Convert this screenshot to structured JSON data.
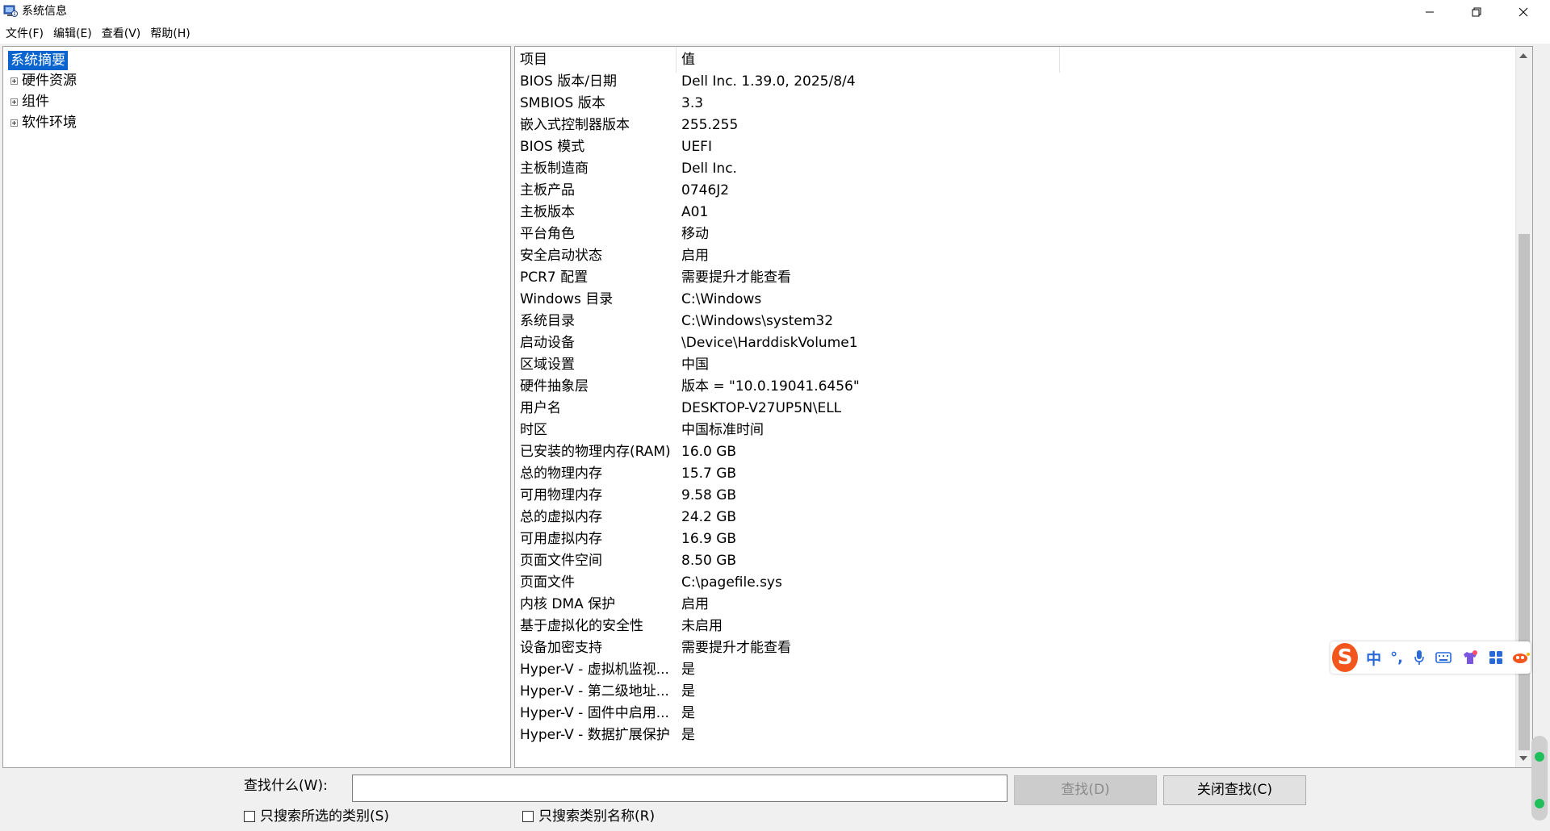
{
  "window": {
    "title": "系统信息"
  },
  "menu": [
    "文件(F)",
    "编辑(E)",
    "查看(V)",
    "帮助(H)"
  ],
  "tree": {
    "root": "系统摘要",
    "children": [
      "硬件资源",
      "组件",
      "软件环境"
    ]
  },
  "list": {
    "headers": {
      "item": "项目",
      "value": "值"
    },
    "rows": [
      {
        "item": "BIOS 版本/日期",
        "value": "Dell Inc. 1.39.0, 2025/8/4"
      },
      {
        "item": "SMBIOS 版本",
        "value": "3.3"
      },
      {
        "item": "嵌入式控制器版本",
        "value": "255.255"
      },
      {
        "item": "BIOS 模式",
        "value": "UEFI"
      },
      {
        "item": "主板制造商",
        "value": "Dell Inc."
      },
      {
        "item": "主板产品",
        "value": "0746J2"
      },
      {
        "item": "主板版本",
        "value": "A01"
      },
      {
        "item": "平台角色",
        "value": "移动"
      },
      {
        "item": "安全启动状态",
        "value": "启用"
      },
      {
        "item": "PCR7 配置",
        "value": "需要提升才能查看"
      },
      {
        "item": "Windows 目录",
        "value": "C:\\Windows"
      },
      {
        "item": "系统目录",
        "value": "C:\\Windows\\system32"
      },
      {
        "item": "启动设备",
        "value": "\\Device\\HarddiskVolume1"
      },
      {
        "item": "区域设置",
        "value": "中国"
      },
      {
        "item": "硬件抽象层",
        "value": "版本 = \"10.0.19041.6456\""
      },
      {
        "item": "用户名",
        "value": "DESKTOP-V27UP5N\\ELL"
      },
      {
        "item": "时区",
        "value": "中国标准时间"
      },
      {
        "item": "已安装的物理内存(RAM)",
        "value": "16.0 GB"
      },
      {
        "item": "总的物理内存",
        "value": "15.7 GB"
      },
      {
        "item": "可用物理内存",
        "value": "9.58 GB"
      },
      {
        "item": "总的虚拟内存",
        "value": "24.2 GB"
      },
      {
        "item": "可用虚拟内存",
        "value": "16.9 GB"
      },
      {
        "item": "页面文件空间",
        "value": "8.50 GB"
      },
      {
        "item": "页面文件",
        "value": "C:\\pagefile.sys"
      },
      {
        "item": "内核 DMA 保护",
        "value": "启用"
      },
      {
        "item": "基于虚拟化的安全性",
        "value": "未启用"
      },
      {
        "item": "设备加密支持",
        "value": "需要提升才能查看"
      },
      {
        "item": "Hyper-V - 虚拟机监视...",
        "value": "是"
      },
      {
        "item": "Hyper-V - 第二级地址...",
        "value": "是"
      },
      {
        "item": "Hyper-V - 固件中启用...",
        "value": "是"
      },
      {
        "item": "Hyper-V - 数据扩展保护",
        "value": "是"
      }
    ]
  },
  "search": {
    "label": "查找什么(W):",
    "value": "",
    "find_button": "查找(D)",
    "close_button": "关闭查找(C)",
    "checkbox_selected_category": "只搜索所选的类别(S)",
    "checkbox_category_names": "只搜索类别名称(R)"
  },
  "ime": {
    "logo": "S",
    "mode": "中",
    "punct": "°,"
  },
  "colors": {
    "selection": "#0a64d0",
    "ime_brand": "#f2561d",
    "ime_text": "#2a6ad8"
  }
}
